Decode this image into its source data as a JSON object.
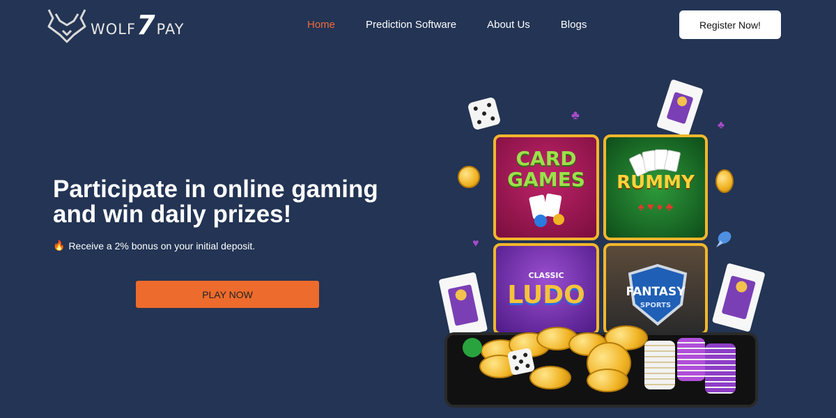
{
  "brand": {
    "logo_text_left": "WOLF",
    "logo_seven": "7",
    "logo_text_right": "PAY"
  },
  "nav": {
    "items": [
      {
        "label": "Home",
        "active": true
      },
      {
        "label": "Prediction Software",
        "active": false
      },
      {
        "label": "About Us",
        "active": false
      },
      {
        "label": "Blogs",
        "active": false
      }
    ],
    "register_label": "Register Now!"
  },
  "hero": {
    "title": "Participate in online gaming and win daily prizes!",
    "subtitle": "Receive a 2% bonus on your initial deposit.",
    "subtitle_icon": "fire-icon",
    "cta_label": "PLAY NOW"
  },
  "illustration": {
    "tiles": [
      {
        "line1": "CARD",
        "line2": "GAMES"
      },
      {
        "line1": "RUMMY"
      },
      {
        "line1": "CLASSIC",
        "line2": "LUDO"
      },
      {
        "line1": "FANTASY",
        "line2": "SPORTS"
      }
    ]
  },
  "colors": {
    "background": "#233454",
    "accent": "#ed6b2c",
    "nav_active": "#f06b3a",
    "tile_border": "#f2b62c"
  }
}
